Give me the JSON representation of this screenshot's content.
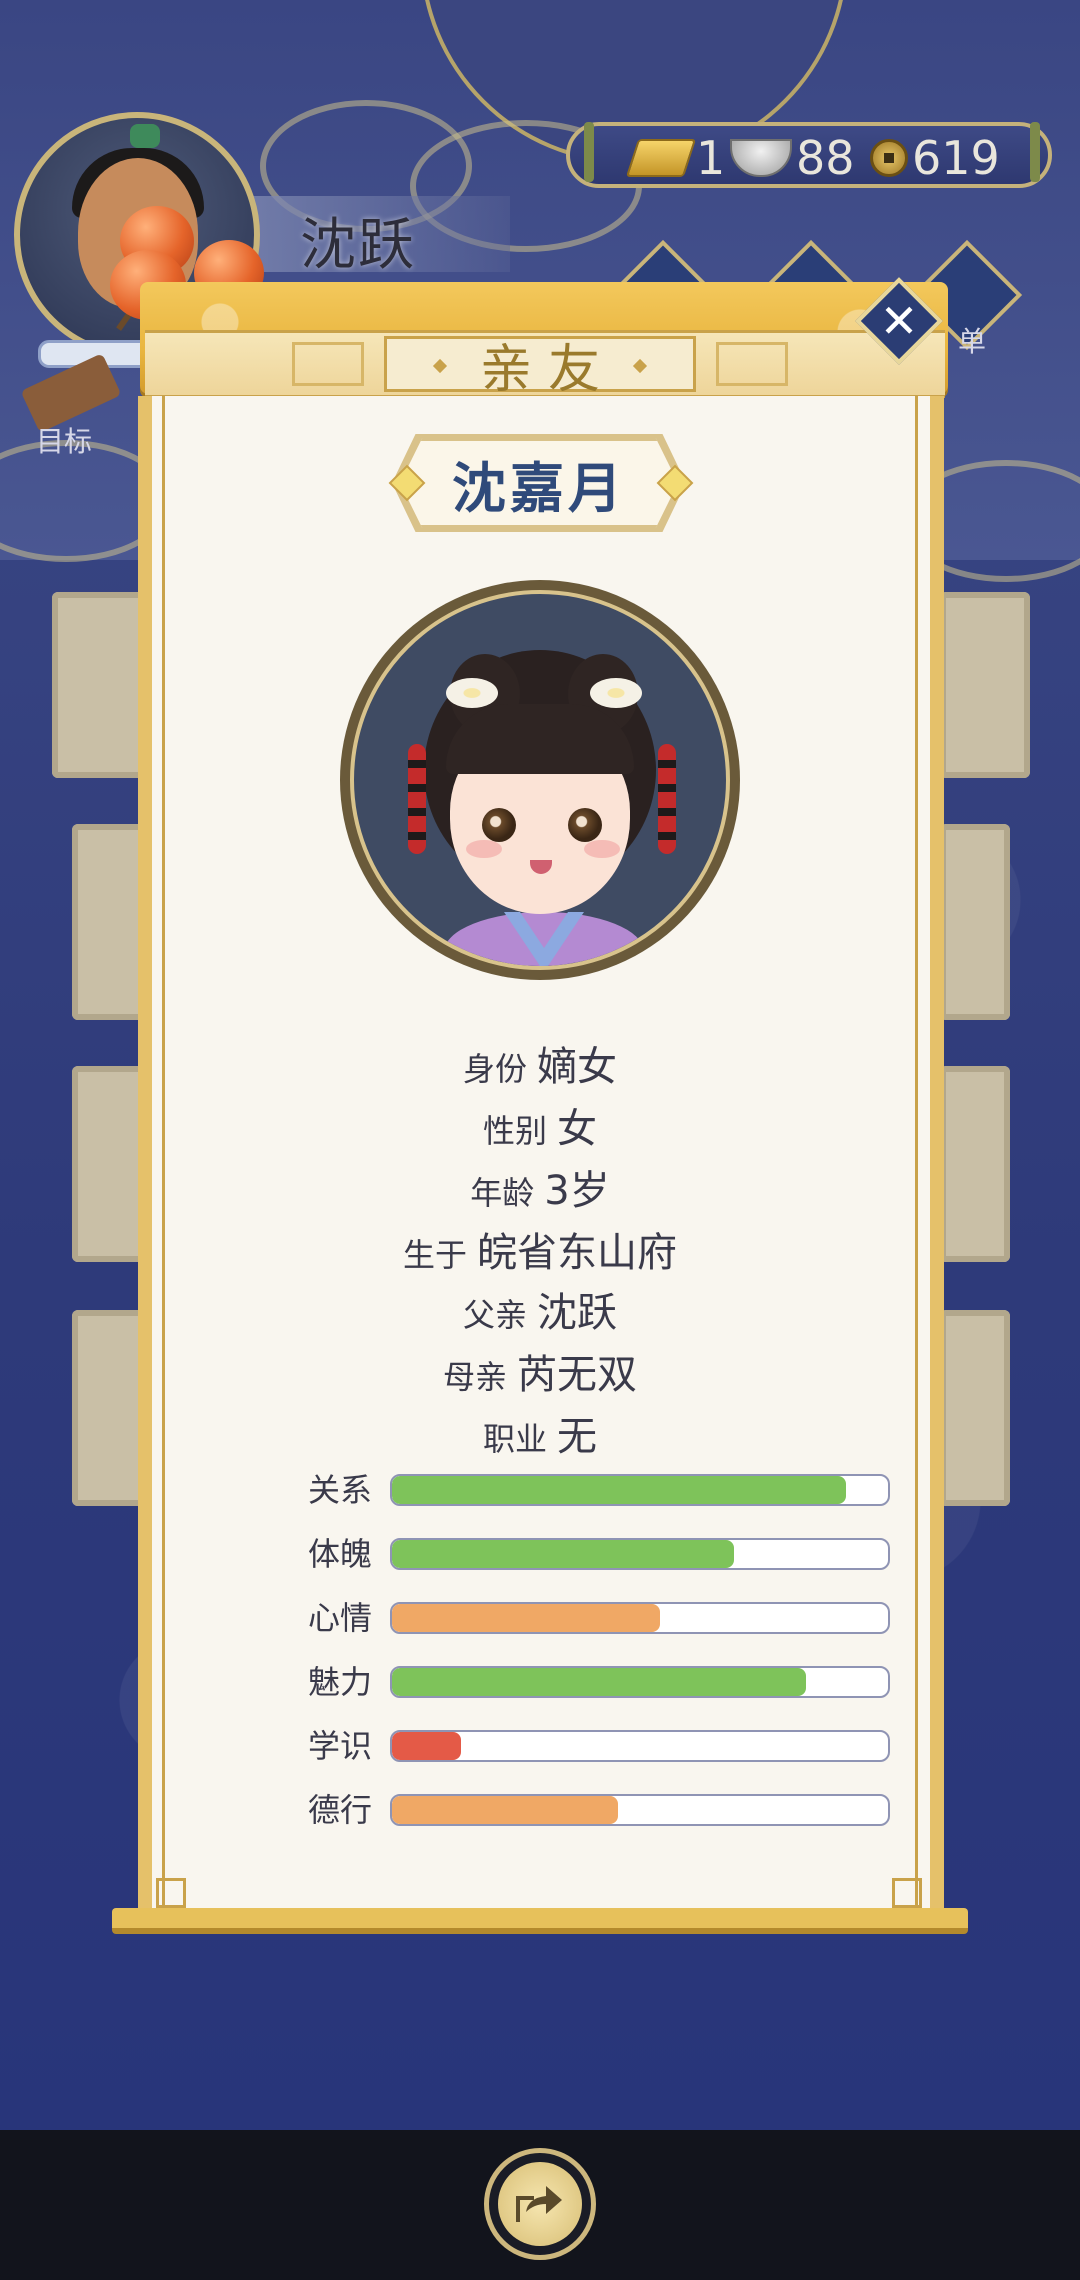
{
  "hud": {
    "player_name": "沈跃",
    "goal_label": "目标",
    "menu_label": "单",
    "currency": {
      "gold": "1",
      "silver": "88",
      "coins": "619"
    }
  },
  "dialog": {
    "title": "亲友",
    "character_name": "沈嘉月",
    "info": [
      {
        "label": "身份",
        "value": "嫡女"
      },
      {
        "label": "性别",
        "value": "女"
      },
      {
        "label": "年龄",
        "value": "3岁"
      },
      {
        "label": "生于",
        "value": "皖省东山府"
      },
      {
        "label": "父亲",
        "value": "沈跃"
      },
      {
        "label": "母亲",
        "value": "芮无双"
      },
      {
        "label": "职业",
        "value": "无"
      }
    ],
    "stats": [
      {
        "label": "关系",
        "level": 0.915,
        "color": "#7ec35a"
      },
      {
        "label": "体魄",
        "level": 0.69,
        "color": "#7ec35a"
      },
      {
        "label": "心情",
        "level": 0.54,
        "color": "#f0a865"
      },
      {
        "label": "魅力",
        "level": 0.835,
        "color": "#7ec35a"
      },
      {
        "label": "学识",
        "level": 0.14,
        "color": "#e45a47"
      },
      {
        "label": "德行",
        "level": 0.455,
        "color": "#f0a865"
      }
    ],
    "close_icon": "close-icon"
  },
  "bottom": {
    "share_icon": "share-icon"
  }
}
